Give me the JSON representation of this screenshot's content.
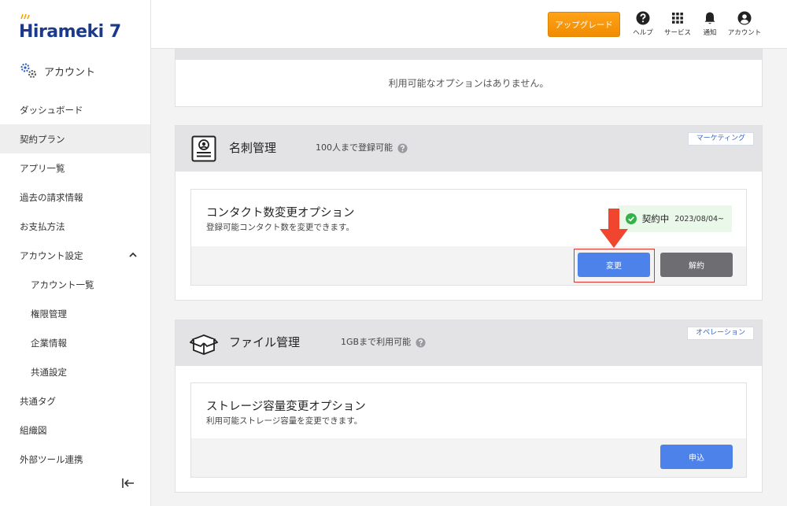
{
  "app": {
    "logo_text": "Hirameki 7",
    "brand_color": "#1c3a8c"
  },
  "sidebar": {
    "account_label": "アカウント",
    "items": [
      {
        "label": "ダッシュボード",
        "active": false,
        "sub": false
      },
      {
        "label": "契約プラン",
        "active": true,
        "sub": false
      },
      {
        "label": "アプリ一覧",
        "active": false,
        "sub": false
      },
      {
        "label": "過去の請求情報",
        "active": false,
        "sub": false
      },
      {
        "label": "お支払方法",
        "active": false,
        "sub": false
      },
      {
        "label": "アカウント設定",
        "active": false,
        "sub": false,
        "expanded": true
      },
      {
        "label": "アカウント一覧",
        "active": false,
        "sub": true
      },
      {
        "label": "権限管理",
        "active": false,
        "sub": true
      },
      {
        "label": "企業情報",
        "active": false,
        "sub": true
      },
      {
        "label": "共通設定",
        "active": false,
        "sub": true
      },
      {
        "label": "共通タグ",
        "active": false,
        "sub": false
      },
      {
        "label": "組織図",
        "active": false,
        "sub": false
      },
      {
        "label": "外部ツール連携",
        "active": false,
        "sub": false
      }
    ]
  },
  "topbar": {
    "upgrade_label": "アップグレード",
    "help_label": "ヘルプ",
    "services_label": "サービス",
    "notifications_label": "通知",
    "account_label": "アカウント"
  },
  "main": {
    "empty_message": "利用可能なオプションはありません。",
    "sections": [
      {
        "title": "名刺管理",
        "subtitle": "100人まで登録可能",
        "tag": "マーケティング",
        "option": {
          "title": "コンタクト数変更オプション",
          "description": "登録可能コンタクト数を変更できます。",
          "status_label": "契約中",
          "status_date": "2023/08/04~",
          "primary_button": "変更",
          "secondary_button": "解約"
        }
      },
      {
        "title": "ファイル管理",
        "subtitle": "1GBまで利用可能",
        "tag": "オペレーション",
        "option": {
          "title": "ストレージ容量変更オプション",
          "description": "利用可能ストレージ容量を変更できます。",
          "primary_button": "申込"
        }
      }
    ]
  },
  "colors": {
    "accent": "#4d82ea",
    "upgrade": "#f39200",
    "annotation": "#e8312b",
    "status_ok": "#33b249"
  }
}
